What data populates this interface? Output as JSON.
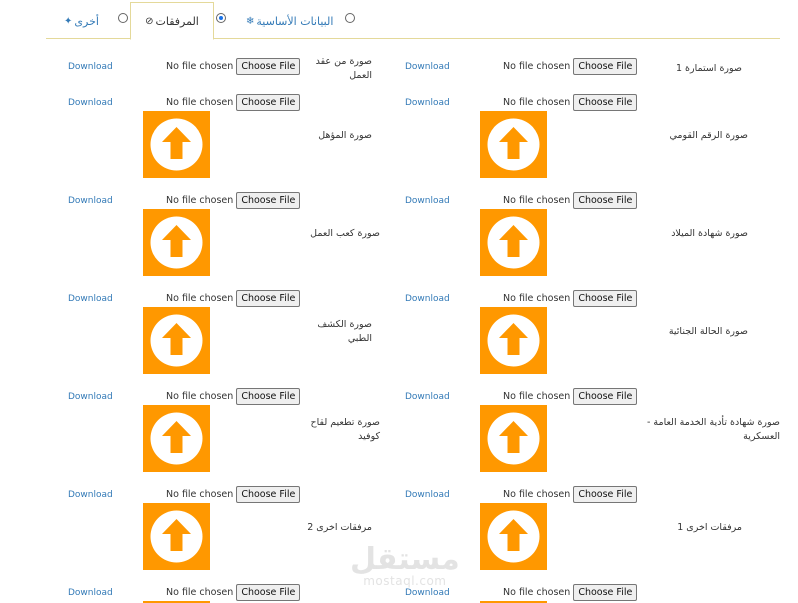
{
  "tabs": [
    {
      "label": "أخرى",
      "icon": "dropbox-icon",
      "active": false
    },
    {
      "label": "المرفقات",
      "icon": "paperclip-icon",
      "active": true
    },
    {
      "label": "البيانات الأساسية",
      "icon": "gear-icon",
      "active": false
    }
  ],
  "common": {
    "download": "Download",
    "no_file": "No file chosen",
    "choose_file": "Choose File"
  },
  "right_fields": [
    "صورة استمارة 1",
    "صورة الرقم القومي",
    "صورة شهادة الميلاد",
    "صورة الحالة الجنائية",
    "صورة شهادة تأدية الخدمة العامة - العسكرية",
    "مرفقات اخرى 1"
  ],
  "left_fields": [
    "صورة من عقد العمل",
    "صورة المؤهل",
    "صورة كعب العمل",
    "صورة الكشف الطبي",
    "صورة تطعيم لقاح كوفيد",
    "مرفقات اخرى 2"
  ],
  "watermark": {
    "arabic": "مستقل",
    "latin": "mostaql.com"
  },
  "colors": {
    "upload_thumb": "#ff9800",
    "link": "#337ab7",
    "tab_border": "#e4d99a"
  }
}
